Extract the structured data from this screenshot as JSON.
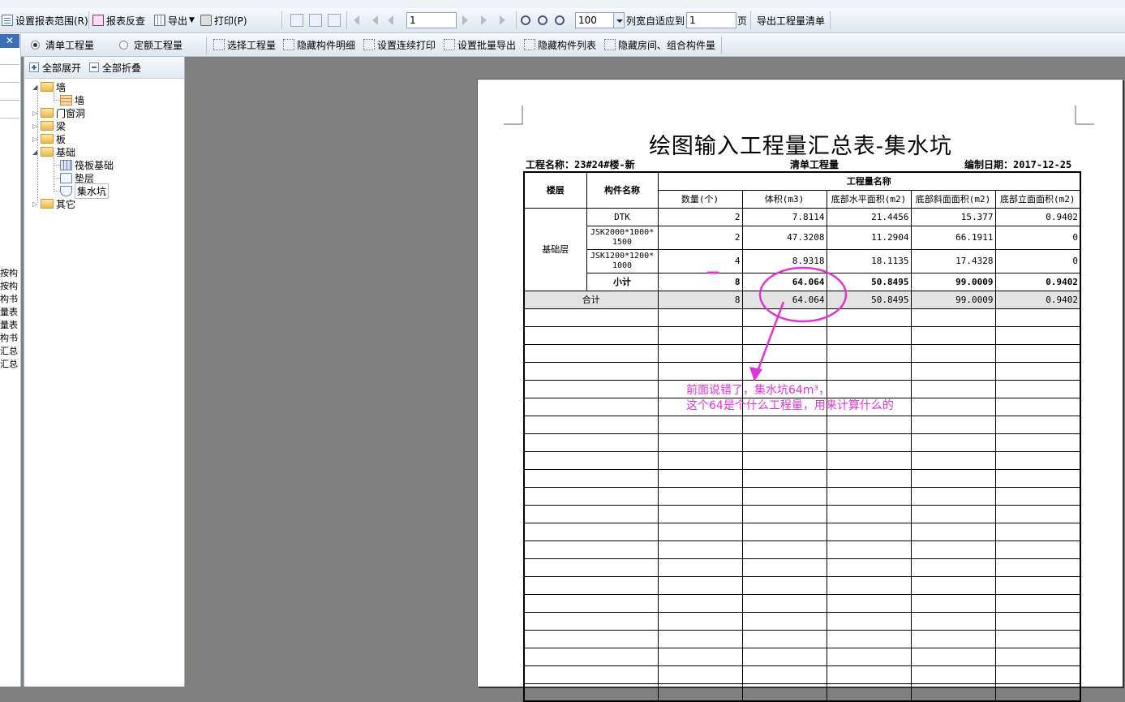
{
  "toolbar1": {
    "set_range": "设置报表范围(R)",
    "reverse": "报表反查",
    "export": "导出",
    "print": "打印(P)",
    "page": "1",
    "zoom": "100",
    "fit_label": "列宽自适应到",
    "fit_value": "1",
    "page_unit": "页",
    "export_list": "导出工程量清单"
  },
  "toolbar2": {
    "radio_list": "清单工程量",
    "radio_quota": "定额工程量",
    "select_qty": "选择工程量",
    "hide_detail": "隐藏构件明细",
    "set_print": "设置连续打印",
    "set_export": "设置批量导出",
    "hide_list": "隐藏构件列表",
    "hide_room": "隐藏房间、组合构件量"
  },
  "leftstrip": {
    "close": "✕",
    "items": [
      "按构",
      "按构",
      "构书",
      "量表",
      "量表",
      "构书",
      "汇总",
      "汇总"
    ]
  },
  "tree": {
    "expand_all": "全部展开",
    "collapse_all": "全部折叠",
    "nodes": {
      "wall": "墙",
      "wall_child": "墙",
      "door": "门窗洞",
      "beam": "梁",
      "slab": "板",
      "foundation": "基础",
      "raft": "筏板基础",
      "cushion": "垫层",
      "sump": "集水坑",
      "other": "其它"
    }
  },
  "report": {
    "title": "绘图输入工程量汇总表-集水坑",
    "project": "工程名称：23#24#楼-新",
    "type": "清单工程量",
    "date": "编制日期：2017-12-25",
    "headers": {
      "floor": "楼层",
      "component": "构件名称",
      "qty_group": "工程量名称",
      "cols": [
        "数量(个)",
        "体积(m3)",
        "底部水平面积(m2)",
        "底部斜面面积(m2)",
        "底部立面面积(m2)"
      ]
    },
    "floor_name": "基础层",
    "rows": [
      {
        "name": "DTK",
        "vals": [
          "2",
          "7.8114",
          "21.4456",
          "15.377",
          "0.9402"
        ]
      },
      {
        "name": "JSK2000*1000*1500",
        "vals": [
          "2",
          "47.3208",
          "11.2904",
          "66.1911",
          "0"
        ]
      },
      {
        "name": "JSK1200*1200*1000",
        "vals": [
          "4",
          "8.9318",
          "18.1135",
          "17.4328",
          "0"
        ]
      }
    ],
    "subtotal": {
      "label": "小计",
      "vals": [
        "8",
        "64.064",
        "50.8495",
        "99.0009",
        "0.9402"
      ]
    },
    "total": {
      "label": "合计",
      "vals": [
        "8",
        "64.064",
        "50.8495",
        "99.0009",
        "0.9402"
      ]
    }
  },
  "annotation": {
    "line1": "前面说错了，集水坑64m³，",
    "line2": "这个64是个什么工程量，用来计算什么的",
    "color": "#e033d8"
  }
}
